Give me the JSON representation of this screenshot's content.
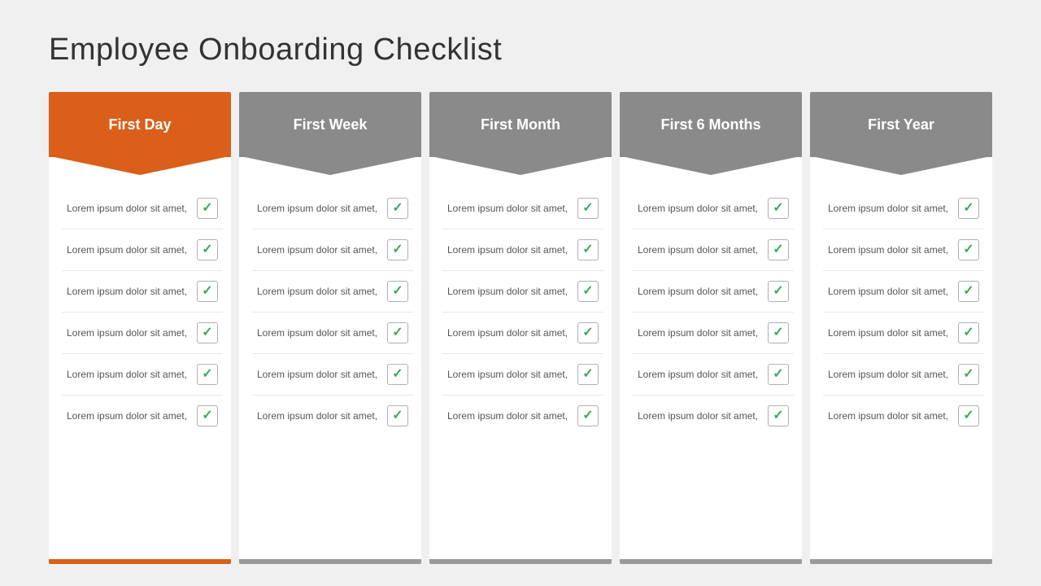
{
  "title": "Employee  Onboarding Checklist",
  "columns": [
    {
      "id": "first-day",
      "label": "First Day",
      "colorClass": "col-first-day",
      "items": [
        {
          "text": "Lorem ipsum dolor sit amet,"
        },
        {
          "text": "Lorem ipsum dolor sit amet,"
        },
        {
          "text": "Lorem ipsum dolor sit amet,"
        },
        {
          "text": "Lorem ipsum dolor sit amet,"
        },
        {
          "text": "Lorem ipsum dolor sit amet,"
        },
        {
          "text": "Lorem ipsum dolor sit amet,"
        }
      ]
    },
    {
      "id": "first-week",
      "label": "First Week",
      "colorClass": "col-first-week",
      "items": [
        {
          "text": "Lorem ipsum dolor sit amet,"
        },
        {
          "text": "Lorem ipsum dolor sit amet,"
        },
        {
          "text": "Lorem ipsum dolor sit amet,"
        },
        {
          "text": "Lorem ipsum dolor sit amet,"
        },
        {
          "text": "Lorem ipsum dolor sit amet,"
        },
        {
          "text": "Lorem ipsum dolor sit amet,"
        }
      ]
    },
    {
      "id": "first-month",
      "label": "First Month",
      "colorClass": "col-first-month",
      "items": [
        {
          "text": "Lorem ipsum dolor sit amet,"
        },
        {
          "text": "Lorem ipsum dolor sit amet,"
        },
        {
          "text": "Lorem ipsum dolor sit amet,"
        },
        {
          "text": "Lorem ipsum dolor sit amet,"
        },
        {
          "text": "Lorem ipsum dolor sit amet,"
        },
        {
          "text": "Lorem ipsum dolor sit amet,"
        }
      ]
    },
    {
      "id": "first-6months",
      "label": "First 6 Months",
      "colorClass": "col-first-6months",
      "items": [
        {
          "text": "Lorem ipsum dolor sit amet,"
        },
        {
          "text": "Lorem ipsum dolor sit amet,"
        },
        {
          "text": "Lorem ipsum dolor sit amet,"
        },
        {
          "text": "Lorem ipsum dolor sit amet,"
        },
        {
          "text": "Lorem ipsum dolor sit amet,"
        },
        {
          "text": "Lorem ipsum dolor sit amet,"
        }
      ]
    },
    {
      "id": "first-year",
      "label": "First Year",
      "colorClass": "col-first-year",
      "items": [
        {
          "text": "Lorem ipsum dolor sit amet,"
        },
        {
          "text": "Lorem ipsum dolor sit amet,"
        },
        {
          "text": "Lorem ipsum dolor sit amet,"
        },
        {
          "text": "Lorem ipsum dolor sit amet,"
        },
        {
          "text": "Lorem ipsum dolor sit amet,"
        },
        {
          "text": "Lorem ipsum dolor sit amet,"
        }
      ]
    }
  ],
  "checkmark": "✓"
}
